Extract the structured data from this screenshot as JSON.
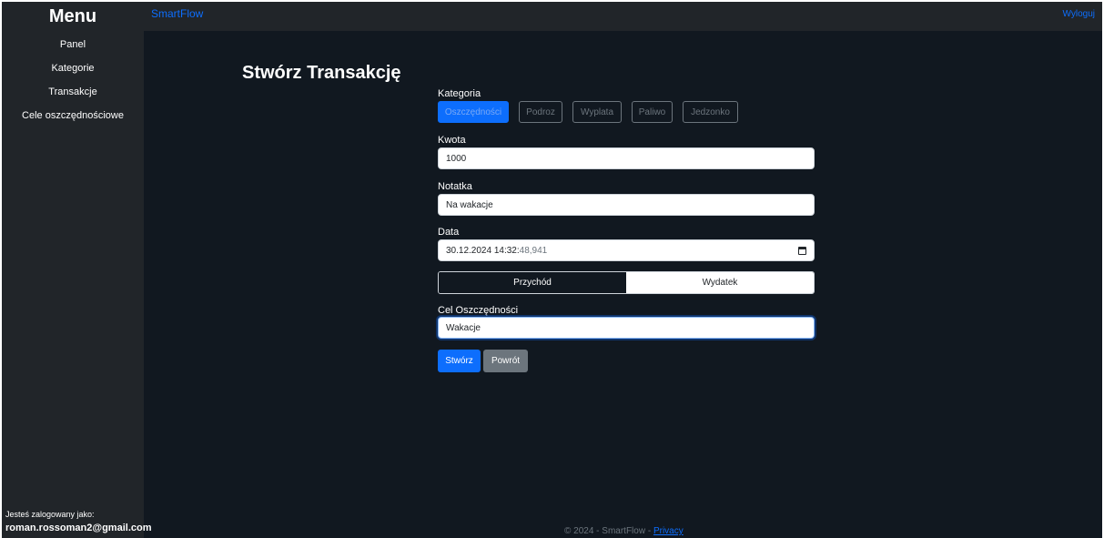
{
  "sidebar": {
    "title": "Menu",
    "items": [
      {
        "label": "Panel"
      },
      {
        "label": "Kategorie"
      },
      {
        "label": "Transakcje"
      },
      {
        "label": "Cele oszczędnościowe"
      }
    ],
    "logged_in_label": "Jesteś zalogowany jako:",
    "logged_in_user": "roman.rossoman2@gmail.com"
  },
  "topbar": {
    "brand": "SmartFlow",
    "logout": "Wyloguj"
  },
  "main": {
    "title": "Stwórz Transakcję",
    "category_label": "Kategoria",
    "categories": [
      {
        "label": "Oszczędności",
        "selected": true
      },
      {
        "label": "Podroz",
        "selected": false
      },
      {
        "label": "Wyplata",
        "selected": false
      },
      {
        "label": "Paliwo",
        "selected": false
      },
      {
        "label": "Jedzonko",
        "selected": false
      }
    ],
    "amount_label": "Kwota",
    "amount_value": "1000",
    "note_label": "Notatka",
    "note_value": "Na wakacje",
    "date_label": "Data",
    "date_value_main": "30.12.2024 14:32:",
    "date_value_dim": "48,941",
    "type_options": [
      {
        "label": "Przychód",
        "selected": true
      },
      {
        "label": "Wydatek",
        "selected": false
      }
    ],
    "goal_label": "Cel Oszczędności",
    "goal_value": "Wakacje",
    "create_button": "Stwórz",
    "back_button": "Powrót"
  },
  "footer": {
    "text": "© 2024 - SmartFlow - ",
    "privacy_link": "Privacy"
  },
  "colors": {
    "accent": "#0d6efd",
    "background": "#111820",
    "sidebar": "#212529",
    "secondary": "#6c757d"
  },
  "icons": {
    "date_picker": "calendar-icon"
  }
}
